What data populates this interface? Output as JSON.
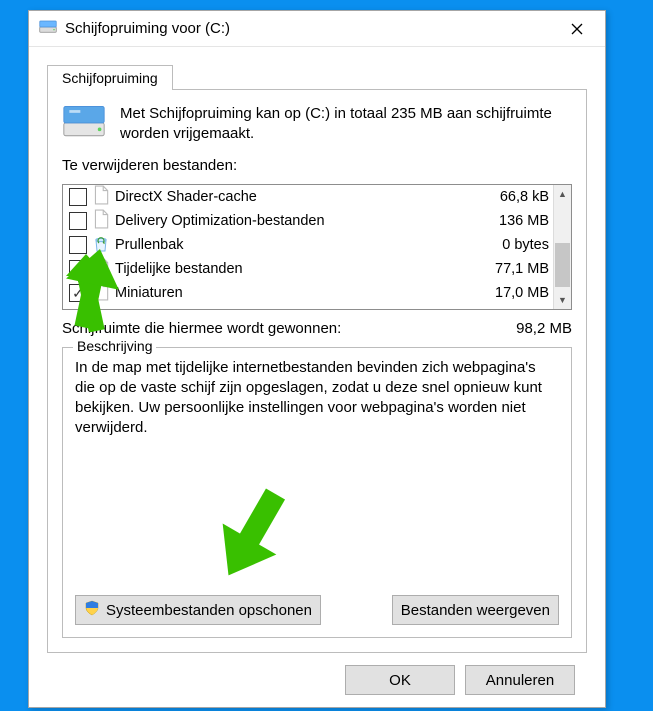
{
  "window": {
    "title": "Schijfopruiming voor  (C:)"
  },
  "tab": {
    "label": "Schijfopruiming"
  },
  "summary": "Met Schijfopruiming kan op  (C:) in totaal 235 MB aan schijfruimte worden vrijgemaakt.",
  "section_label": "Te verwijderen bestanden:",
  "files": [
    {
      "name": "DirectX Shader-cache",
      "size": "66,8 kB",
      "checked": false,
      "icon": "file"
    },
    {
      "name": "Delivery Optimization-bestanden",
      "size": "136 MB",
      "checked": false,
      "icon": "file"
    },
    {
      "name": "Prullenbak",
      "size": "0 bytes",
      "checked": false,
      "icon": "recycle"
    },
    {
      "name": "Tijdelijke bestanden",
      "size": "77,1 MB",
      "checked": true,
      "icon": "file"
    },
    {
      "name": "Miniaturen",
      "size": "17,0 MB",
      "checked": true,
      "icon": "file"
    }
  ],
  "gained": {
    "label": "Schijfruimte die hiermee wordt gewonnen:",
    "value": "98,2 MB"
  },
  "description": {
    "legend": "Beschrijving",
    "text": "In de map met tijdelijke internetbestanden bevinden zich webpagina's die op de vaste schijf zijn opgeslagen, zodat u deze snel opnieuw kunt bekijken. Uw persoonlijke instellingen voor webpagina's worden niet verwijderd."
  },
  "buttons": {
    "clean_system": "Systeembestanden opschonen",
    "view_files": "Bestanden weergeven",
    "ok": "OK",
    "cancel": "Annuleren"
  }
}
